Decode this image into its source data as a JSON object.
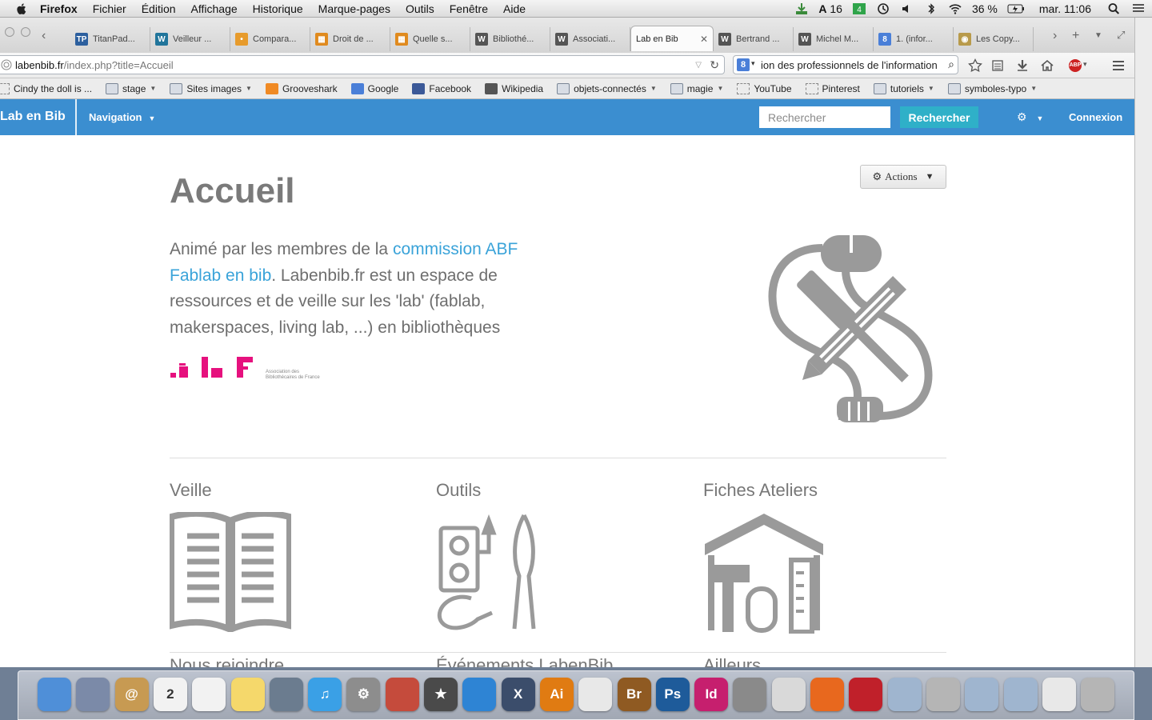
{
  "menubar": {
    "app": "Firefox",
    "items": [
      "Fichier",
      "Édition",
      "Affichage",
      "Historique",
      "Marque-pages",
      "Outils",
      "Fenêtre",
      "Aide"
    ],
    "status": {
      "battery": "36 %",
      "clock": "mar. 11:06",
      "font_count": "16"
    }
  },
  "tabs": [
    {
      "label": "TitanPad...",
      "icon": "TP",
      "color": "#2c5f9e"
    },
    {
      "label": "Veilleur ...",
      "icon": "W",
      "color": "#21759b"
    },
    {
      "label": "Compara...",
      "icon": "•",
      "color": "#e79b2c"
    },
    {
      "label": "Droit de ...",
      "icon": "▦",
      "color": "#e08a1e"
    },
    {
      "label": "Quelle s...",
      "icon": "▦",
      "color": "#e08a1e"
    },
    {
      "label": "Bibliothé...",
      "icon": "W",
      "color": "#555"
    },
    {
      "label": "Associati...",
      "icon": "W",
      "color": "#555"
    },
    {
      "label": "Lab en Bib",
      "icon": "",
      "color": "#fff",
      "active": true
    },
    {
      "label": "Bertrand ...",
      "icon": "W",
      "color": "#555"
    },
    {
      "label": "Michel M...",
      "icon": "W",
      "color": "#555"
    },
    {
      "label": "1. (infor...",
      "icon": "8",
      "color": "#4a7fd8"
    },
    {
      "label": "Les Copy...",
      "icon": "◉",
      "color": "#b89a4a"
    }
  ],
  "navbar": {
    "url_host": "labenbib.fr",
    "url_path": "/index.php?title=Accueil",
    "search_value": "ion des professionnels de l'information"
  },
  "bookmarks": [
    {
      "label": "Cindy the doll is ...",
      "type": "page"
    },
    {
      "label": "stage",
      "type": "folder"
    },
    {
      "label": "Sites images",
      "type": "folder"
    },
    {
      "label": "Grooveshark",
      "type": "link",
      "color": "#f08a24"
    },
    {
      "label": "Google",
      "type": "link",
      "color": "#4a7fd8"
    },
    {
      "label": "Facebook",
      "type": "link",
      "color": "#3b5998"
    },
    {
      "label": "Wikipedia",
      "type": "link",
      "color": "#555"
    },
    {
      "label": "objets-connectés",
      "type": "folder"
    },
    {
      "label": "magie",
      "type": "folder"
    },
    {
      "label": "YouTube",
      "type": "page"
    },
    {
      "label": "Pinterest",
      "type": "page"
    },
    {
      "label": "tutoriels",
      "type": "folder"
    },
    {
      "label": "symboles-typo",
      "type": "folder"
    }
  ],
  "site": {
    "brand": "Lab en Bib",
    "nav_label": "Navigation",
    "search_placeholder": "Rechercher",
    "search_button": "Rechercher",
    "login": "Connexion",
    "actions": "Actions",
    "title": "Accueil",
    "intro_pre": "Animé par les membres de la ",
    "intro_link": "commission ABF Fablab en bib",
    "intro_post": ". Labenbib.fr est un espace de ressources et de veille sur les 'lab' (fablab, makerspaces, living lab, ...) en bibliothèques",
    "abf_line1": "Association des",
    "abf_line2": "Bibliothécaires de France",
    "sections": [
      "Veille",
      "Outils",
      "Fiches Ateliers"
    ],
    "sections_next": [
      "Nous rejoindre",
      "Événements LabenBib",
      "Ailleurs"
    ]
  },
  "colors": {
    "topbar": "#3b8ed0",
    "search_button": "#2fb0c8",
    "link": "#3aa3d9",
    "abf_pink": "#e6117e",
    "icon_gray": "#9a9a9a"
  },
  "dock": [
    {
      "name": "finder",
      "label": "",
      "color": "#4f8fd8"
    },
    {
      "name": "preview",
      "label": "",
      "color": "#7b8aa8"
    },
    {
      "name": "contacts",
      "label": "@",
      "color": "#c79a52"
    },
    {
      "name": "calendar",
      "label": "2",
      "color": "#f2f2f2"
    },
    {
      "name": "reminders",
      "label": "",
      "color": "#f2f2f2"
    },
    {
      "name": "stickies",
      "label": "",
      "color": "#f5d86b"
    },
    {
      "name": "iphoto",
      "label": "",
      "color": "#6b7c8f"
    },
    {
      "name": "itunes",
      "label": "♫",
      "color": "#3aa0e6"
    },
    {
      "name": "system-prefs",
      "label": "⚙",
      "color": "#8d8d8d"
    },
    {
      "name": "automator",
      "label": "",
      "color": "#c54b3c"
    },
    {
      "name": "imovie",
      "label": "★",
      "color": "#4a4a4a"
    },
    {
      "name": "cyberduck",
      "label": "",
      "color": "#2e84d4"
    },
    {
      "name": "xquartz",
      "label": "X",
      "color": "#3b4d6b"
    },
    {
      "name": "illustrator",
      "label": "Ai",
      "color": "#e07b12"
    },
    {
      "name": "textedit",
      "label": "",
      "color": "#e8e8e8"
    },
    {
      "name": "bridge",
      "label": "Br",
      "color": "#8f5a22"
    },
    {
      "name": "photoshop",
      "label": "Ps",
      "color": "#1e5b9a"
    },
    {
      "name": "indesign",
      "label": "Id",
      "color": "#c61f6e"
    },
    {
      "name": "screenshot",
      "label": "",
      "color": "#8a8a8a"
    },
    {
      "name": "grapher",
      "label": "",
      "color": "#d9d9d9"
    },
    {
      "name": "firefox",
      "label": "",
      "color": "#e8681e"
    },
    {
      "name": "acrobat",
      "label": "",
      "color": "#c0202a"
    },
    {
      "name": "documents",
      "label": "",
      "color": "#9fb5cf"
    },
    {
      "name": "disk",
      "label": "",
      "color": "#b5b5b5"
    },
    {
      "name": "applications",
      "label": "",
      "color": "#9fb5cf"
    },
    {
      "name": "downloads",
      "label": "",
      "color": "#9fb5cf"
    },
    {
      "name": "window",
      "label": "",
      "color": "#e8e8e8"
    },
    {
      "name": "trash",
      "label": "",
      "color": "#b5b5b5"
    }
  ]
}
